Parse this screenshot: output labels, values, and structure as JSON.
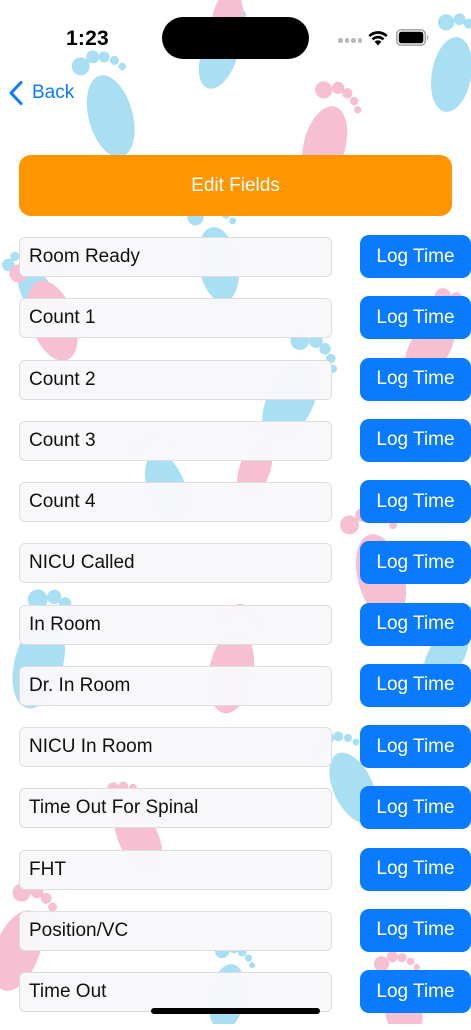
{
  "status_bar": {
    "time": "1:23"
  },
  "nav": {
    "back_label": "Back"
  },
  "actions": {
    "edit_fields_label": "Edit Fields"
  },
  "rows": [
    {
      "label": "Room Ready",
      "button": "Log Time"
    },
    {
      "label": "Count 1",
      "button": "Log Time"
    },
    {
      "label": "Count 2",
      "button": "Log Time"
    },
    {
      "label": "Count 3",
      "button": "Log Time"
    },
    {
      "label": "Count 4",
      "button": "Log Time"
    },
    {
      "label": "NICU Called",
      "button": "Log Time"
    },
    {
      "label": "In Room",
      "button": "Log Time"
    },
    {
      "label": "Dr. In Room",
      "button": "Log Time"
    },
    {
      "label": "NICU In Room",
      "button": "Log Time"
    },
    {
      "label": "Time Out For Spinal",
      "button": "Log Time"
    },
    {
      "label": "FHT",
      "button": "Log Time"
    },
    {
      "label": "Position/VC",
      "button": "Log Time"
    },
    {
      "label": "Time Out",
      "button": "Log Time"
    }
  ],
  "theme": {
    "accent_blue": "#0a7aff",
    "edit_orange": "#ff9500",
    "footprint_blue": "#a9dff3",
    "footprint_pink": "#f7bfd2"
  },
  "icons": {
    "back": "chevron-left-icon",
    "wifi": "wifi-icon",
    "battery": "battery-icon",
    "signal": "cellular-signal-icon",
    "background": "baby-footprints-pattern"
  }
}
